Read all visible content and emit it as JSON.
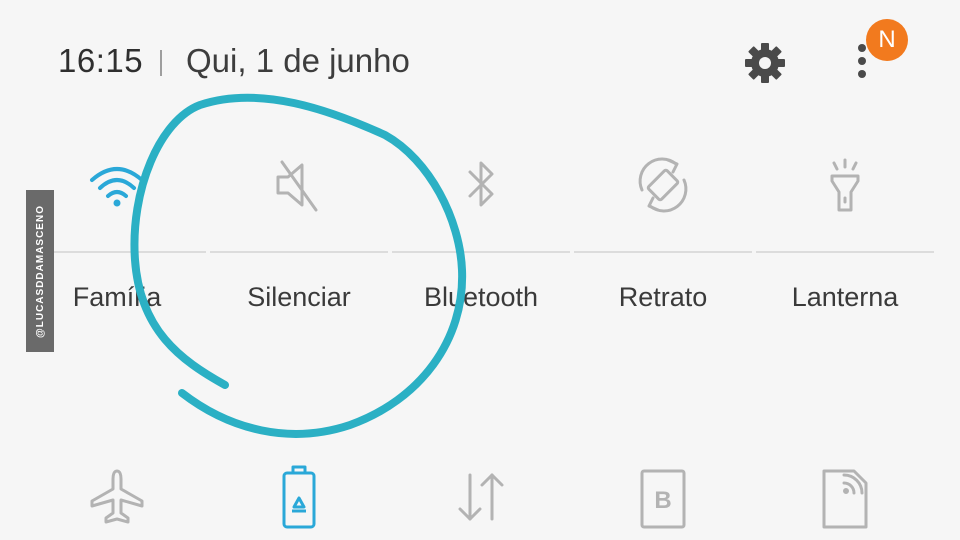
{
  "status": {
    "time": "16:15",
    "date": "Qui, 1 de junho",
    "notification_badge": "N"
  },
  "quick_tiles": [
    {
      "label": "Família",
      "icon": "wifi-icon",
      "active": true
    },
    {
      "label": "Silenciar",
      "icon": "mute-icon",
      "active": false
    },
    {
      "label": "Bluetooth",
      "icon": "bluetooth-icon",
      "active": false
    },
    {
      "label": "Retrato",
      "icon": "rotate-icon",
      "active": false
    },
    {
      "label": "Lanterna",
      "icon": "flashlight-icon",
      "active": false
    }
  ],
  "second_row": [
    {
      "icon": "airplane-icon",
      "active": false
    },
    {
      "icon": "battery-saver-icon",
      "active": true
    },
    {
      "icon": "mobile-data-icon",
      "active": false
    },
    {
      "icon": "blue-light-filter-icon",
      "active": false,
      "letter": "B"
    },
    {
      "icon": "nfc-icon",
      "active": false
    }
  ],
  "watermark": "@LUCASDDAMASCENO",
  "colors": {
    "active": "#2aa8d8",
    "inactive": "#b3b3b3",
    "badge": "#f27a1e",
    "annotation": "#2bb0c4"
  }
}
